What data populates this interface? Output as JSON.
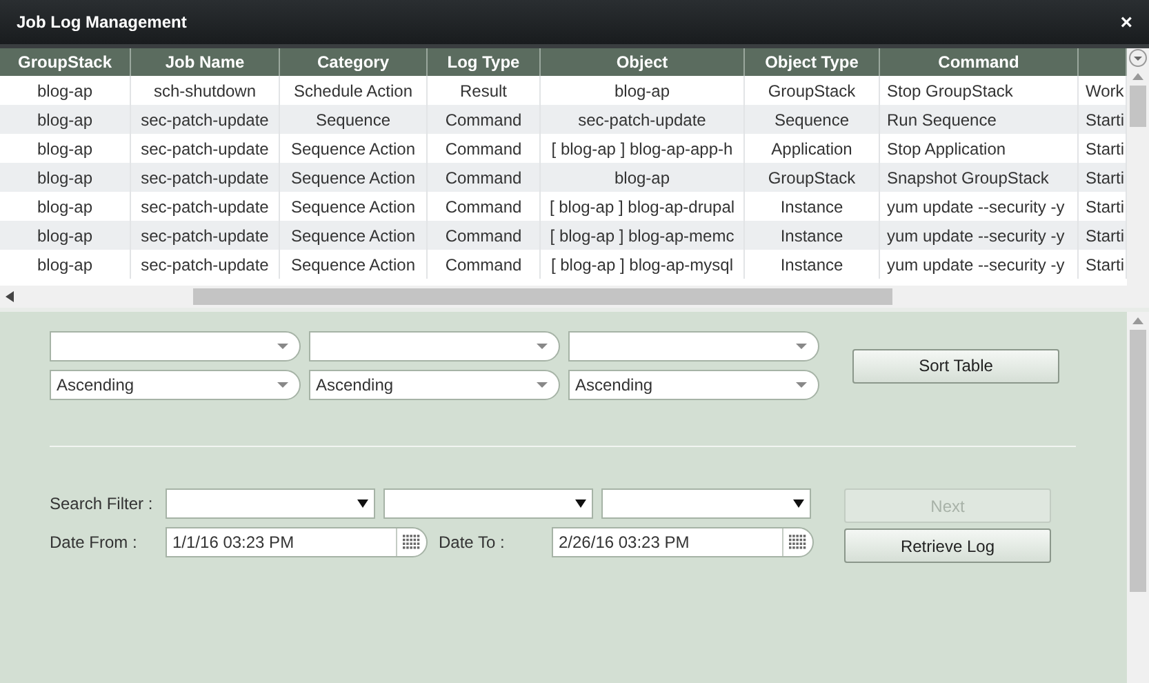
{
  "window": {
    "title": "Job Log Management",
    "close": "×"
  },
  "table": {
    "columns": [
      "GroupStack",
      "Job Name",
      "Category",
      "Log Type",
      "Object",
      "Object Type",
      "Command"
    ],
    "rows": [
      [
        "blog-ap",
        "sch-shutdown",
        "Schedule Action",
        "Result",
        "blog-ap",
        "GroupStack",
        "Stop GroupStack",
        "Work"
      ],
      [
        "blog-ap",
        "sec-patch-update",
        "Sequence",
        "Command",
        "sec-patch-update",
        "Sequence",
        "Run Sequence",
        "Starti"
      ],
      [
        "blog-ap",
        "sec-patch-update",
        "Sequence Action",
        "Command",
        "[ blog-ap ] blog-ap-app-h",
        "Application",
        "Stop Application",
        "Starti"
      ],
      [
        "blog-ap",
        "sec-patch-update",
        "Sequence Action",
        "Command",
        "blog-ap",
        "GroupStack",
        "Snapshot GroupStack",
        "Starti"
      ],
      [
        "blog-ap",
        "sec-patch-update",
        "Sequence Action",
        "Command",
        "[ blog-ap ] blog-ap-drupal",
        "Instance",
        "yum update --security -y",
        "Starti"
      ],
      [
        "blog-ap",
        "sec-patch-update",
        "Sequence Action",
        "Command",
        "[ blog-ap ] blog-ap-memc",
        "Instance",
        "yum update --security -y",
        "Starti"
      ],
      [
        "blog-ap",
        "sec-patch-update",
        "Sequence Action",
        "Command",
        "[ blog-ap ] blog-ap-mysql",
        "Instance",
        "yum update --security -y",
        "Starti"
      ]
    ]
  },
  "sort": {
    "orders": [
      "Ascending",
      "Ascending",
      "Ascending"
    ],
    "button": "Sort Table"
  },
  "filter": {
    "label": "Search Filter :",
    "date_from": {
      "label": "Date From :",
      "value": "1/1/16 03:23 PM"
    },
    "date_to": {
      "label": "Date To :",
      "value": "2/26/16 03:23 PM"
    },
    "buttons": [
      {
        "label": "Next",
        "disabled": true
      },
      {
        "label": "Retrieve Log",
        "disabled": false
      }
    ]
  }
}
